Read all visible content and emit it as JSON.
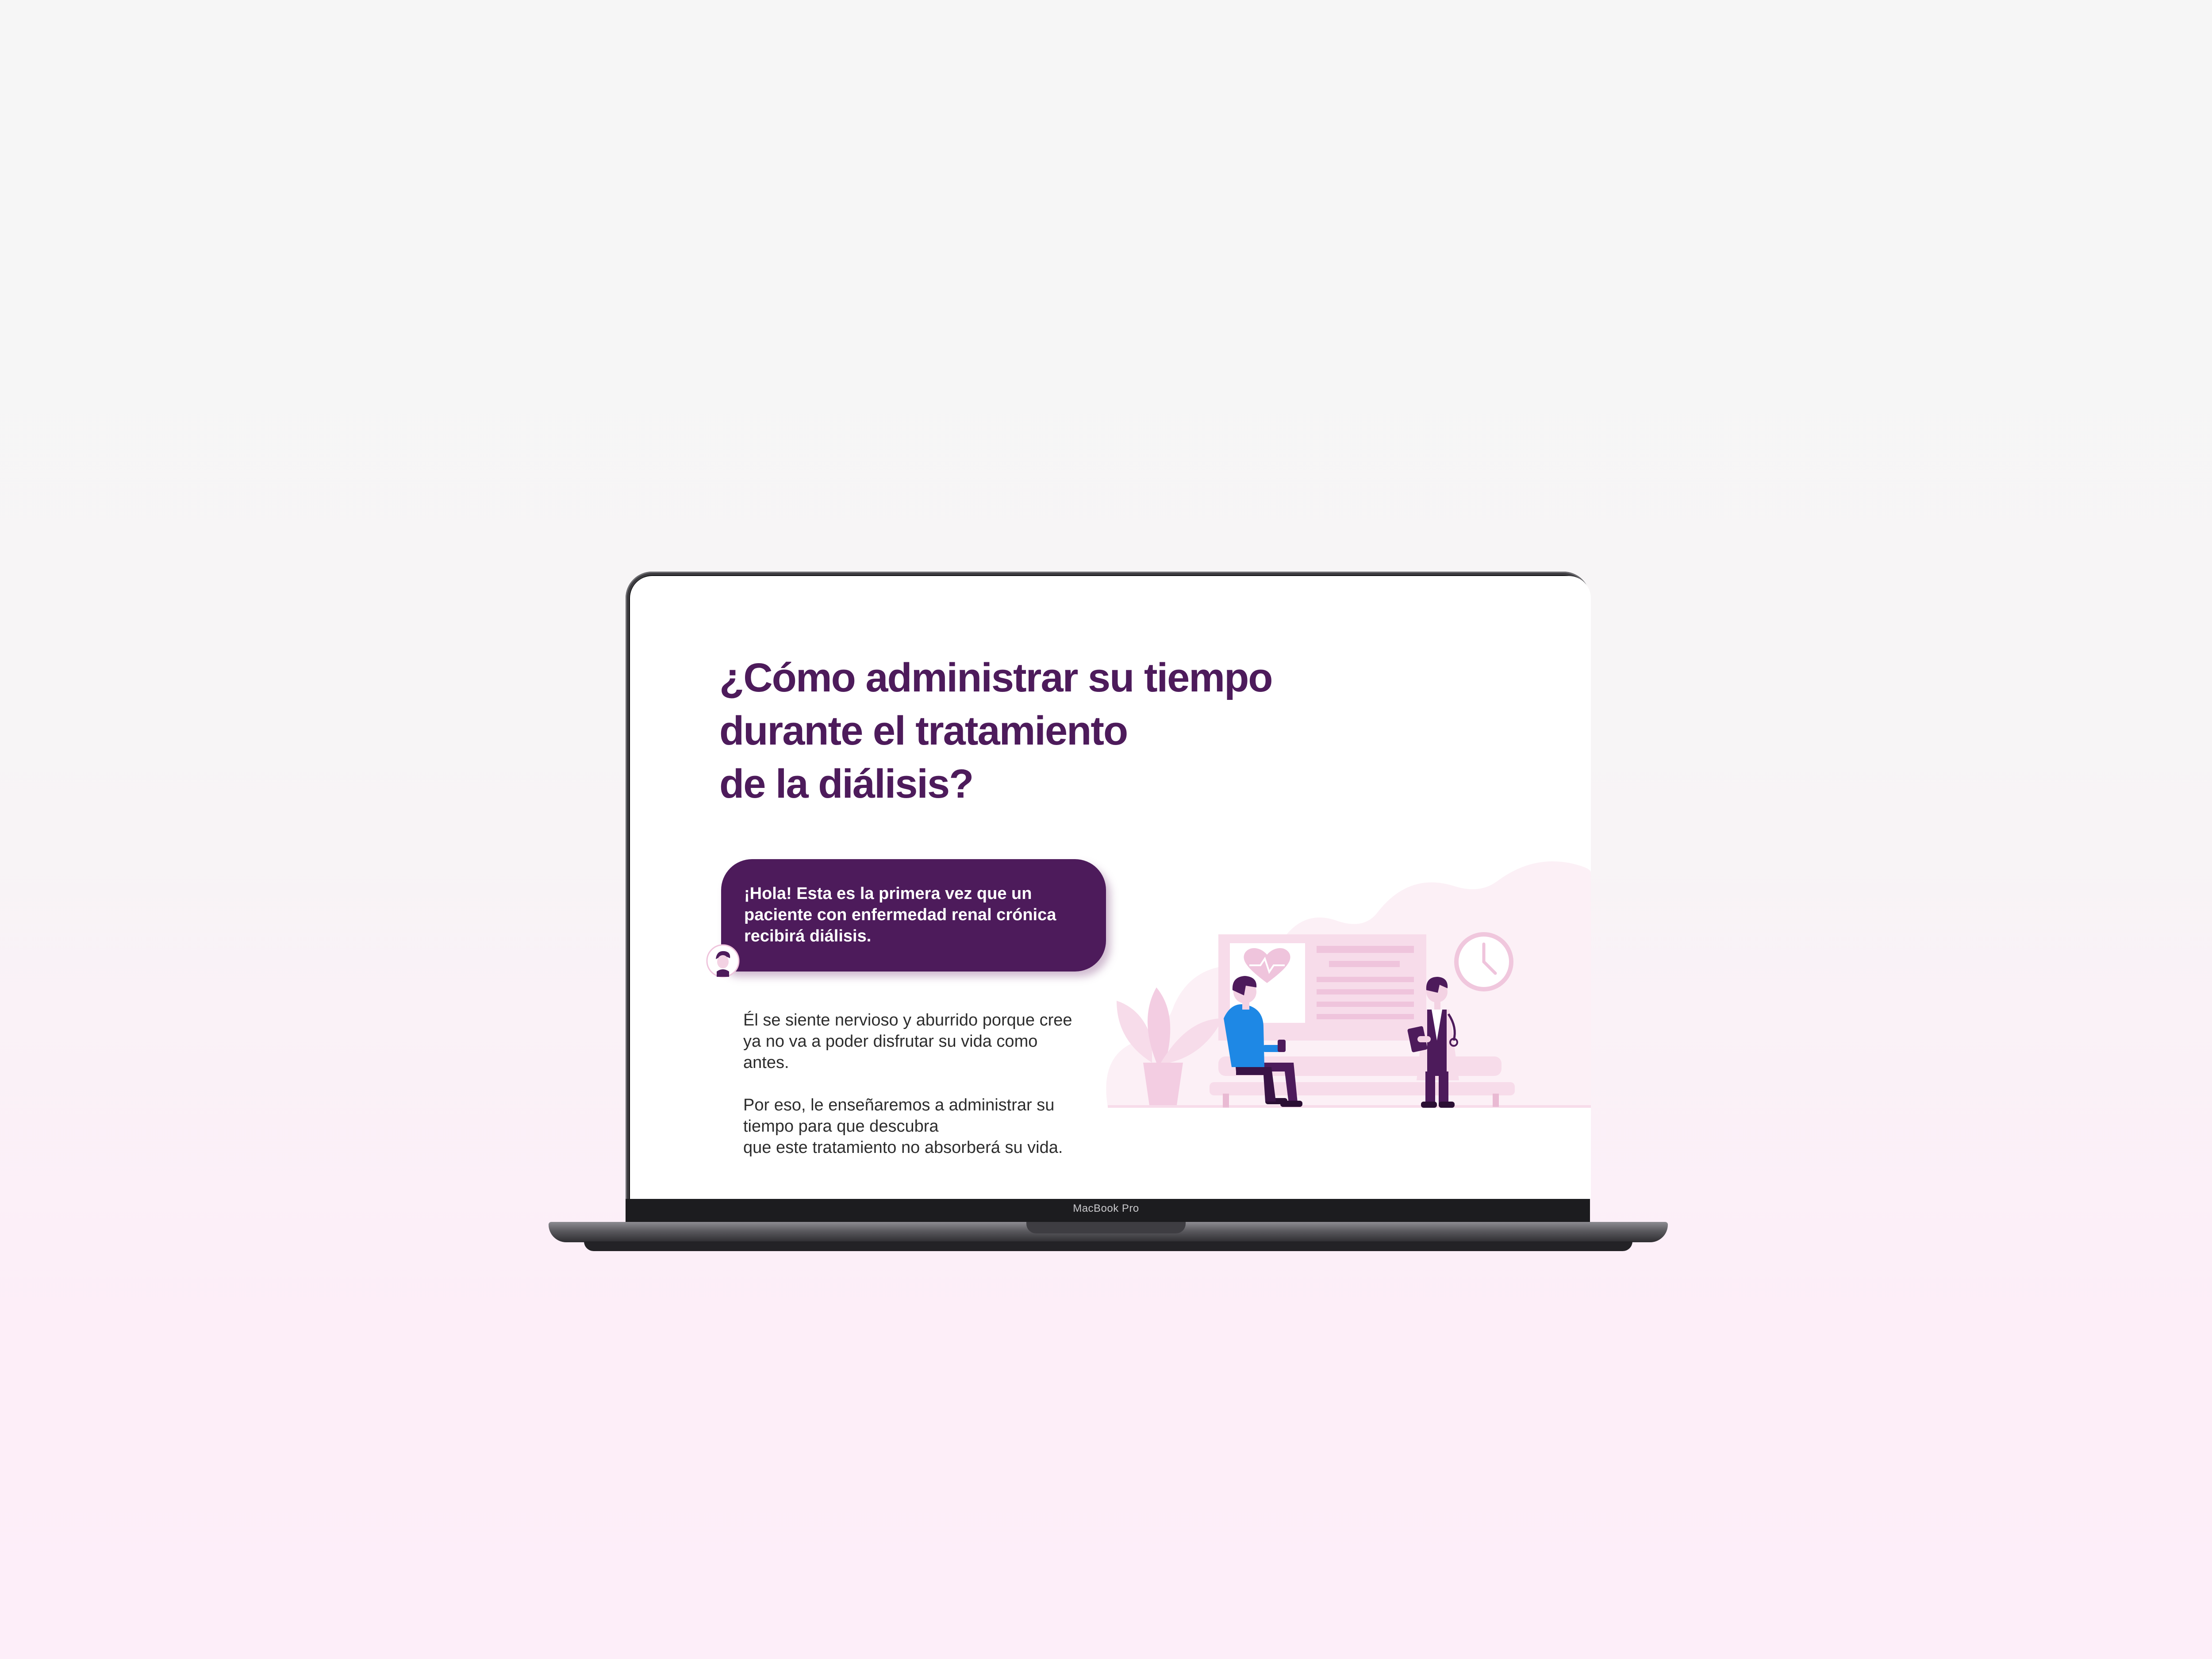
{
  "page": {
    "title_lines": [
      "¿Cómo administrar su tiempo",
      "durante el tratamiento",
      "de la diálisis?"
    ],
    "bubble_lines": [
      "¡Hola! Esta es la primera vez que un",
      "paciente con enfermedad renal crónica",
      "recibirá diálisis."
    ],
    "paragraph1_lines": [
      "Él se siente nervioso y aburrido porque cree",
      "ya no va a poder disfrutar su vida como",
      "antes."
    ],
    "paragraph2_lines": [
      "Por eso, le enseñaremos a administrar su",
      "tiempo para que descubra",
      "que este tratamiento no absorberá su vida."
    ]
  },
  "device": {
    "label": "MacBook Pro"
  },
  "icons": {
    "avatar": "patient-avatar-icon",
    "illustration": "clinic-waiting-room-illustration",
    "clock": "wall-clock-icon",
    "heart": "heartbeat-icon"
  },
  "colors": {
    "brand_purple": "#4d1b5b",
    "pink_light": "#f7dcea",
    "pink_mid": "#efc4dc",
    "patient_shirt": "#1e88e5",
    "background_top": "#f6f6f6",
    "background_bottom": "#fdeef9"
  }
}
